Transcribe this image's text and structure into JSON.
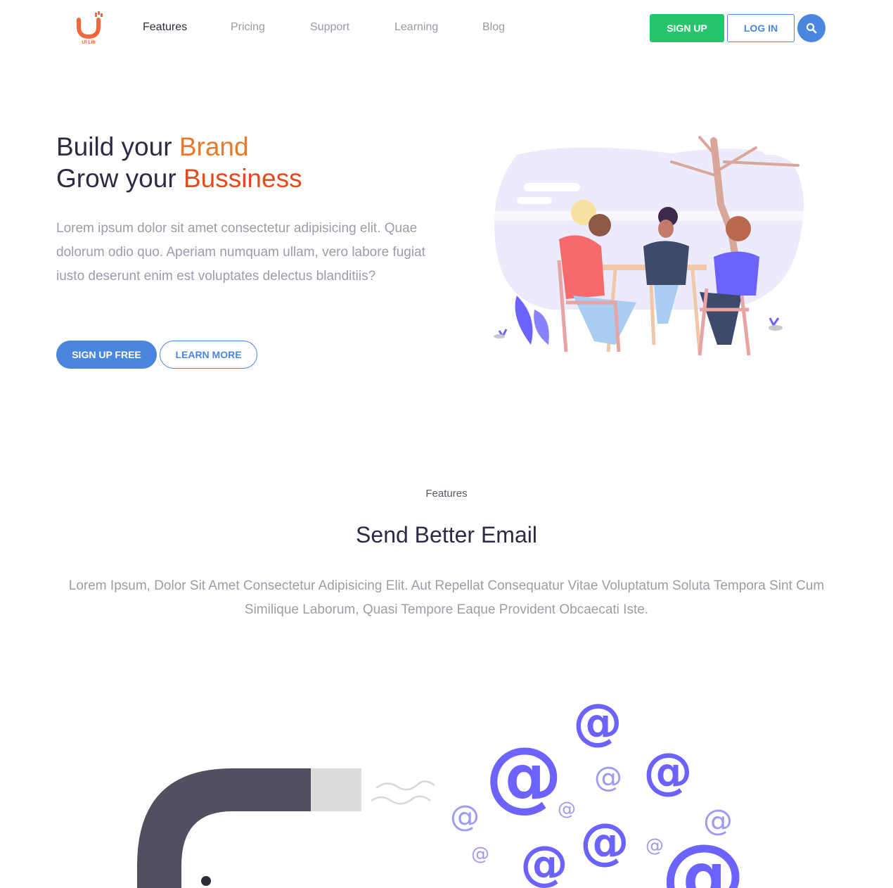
{
  "brand": {
    "name": "UI Lib",
    "accent": "#f2683b"
  },
  "nav": {
    "links": [
      "Features",
      "Pricing",
      "Support",
      "Learning",
      "Blog"
    ],
    "active": "Features",
    "signup_label": "SIGN UP",
    "login_label": "LOG IN",
    "search_icon": "search-icon"
  },
  "hero": {
    "line1_prefix": "Build your ",
    "line1_accent": "Brand",
    "line2_prefix": "Grow your ",
    "line2_accent": "Bussiness",
    "body": "Lorem ipsum dolor sit amet consectetur adipisicing elit. Quae dolorum odio quo. Aperiam numquam ullam, vero labore fugiat iusto deserunt enim est voluptates delectus blanditiis?",
    "primary_cta": "SIGN UP FREE",
    "secondary_cta": "LEARN MORE"
  },
  "features": {
    "eyebrow": "Features",
    "title": "Send Better Email",
    "body": "Lorem Ipsum, Dolor Sit Amet Consectetur Adipisicing Elit. Aut Repellat Consequatur Vitae Voluptatum Soluta Tempora Sint Cum Similique Laborum, Quasi Tempore Eaque Provident Obcaecati Iste."
  },
  "colors": {
    "primary": "#4a86e0",
    "success": "#27c46b",
    "accent_orange": "#e8792a",
    "accent_red": "#e34b1c",
    "illustration_purple": "#6c63ff"
  }
}
